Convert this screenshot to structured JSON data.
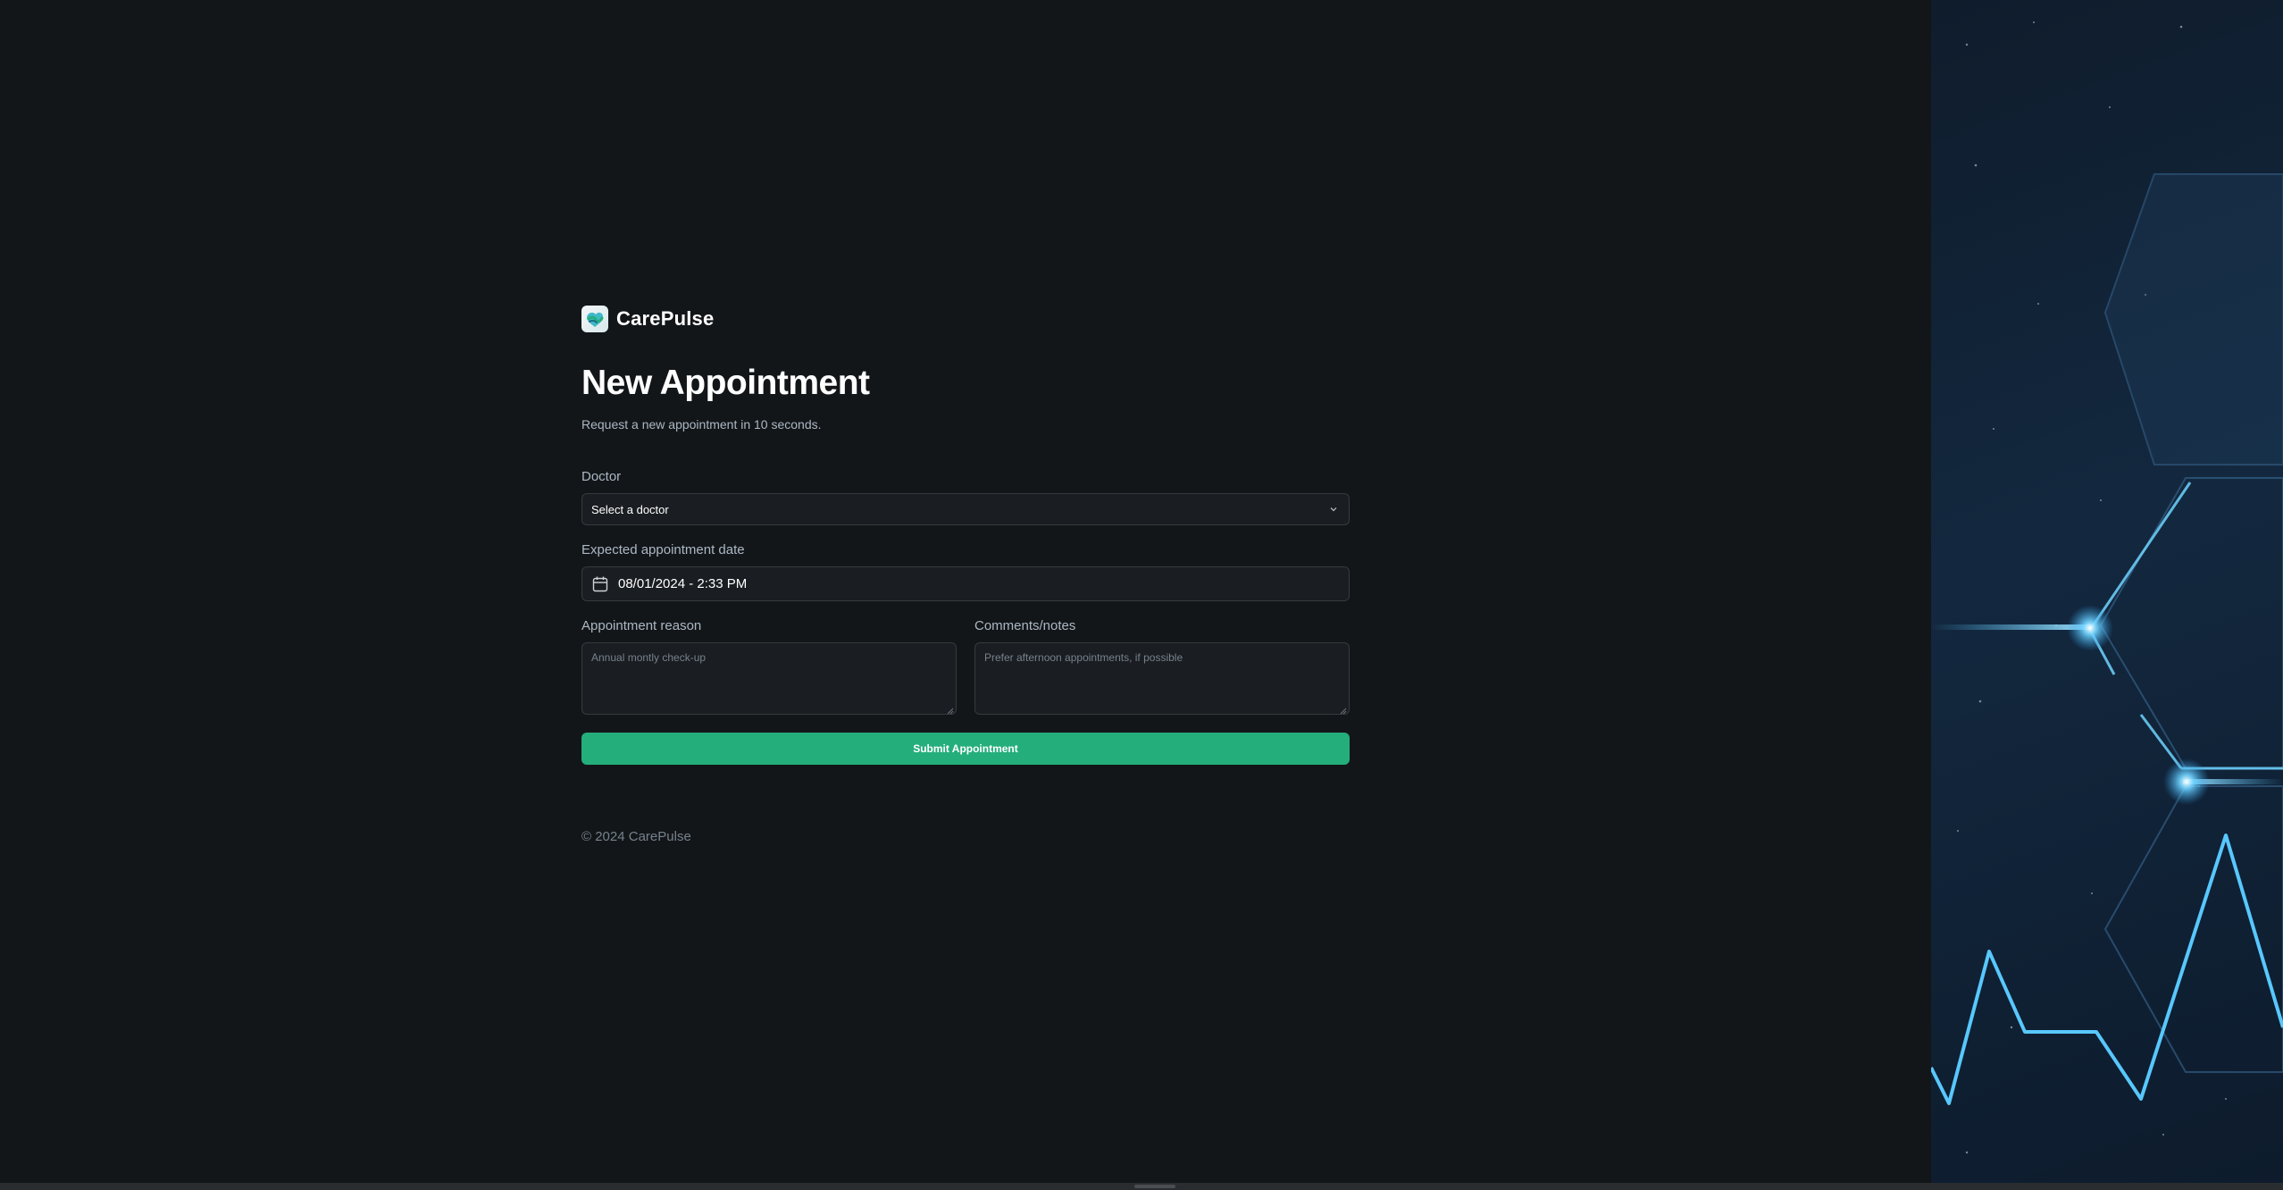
{
  "brand": {
    "name": "CarePulse"
  },
  "header": {
    "title": "New Appointment",
    "subtitle": "Request a new appointment in 10 seconds."
  },
  "form": {
    "doctor": {
      "label": "Doctor",
      "placeholder": "Select a doctor"
    },
    "date": {
      "label": "Expected appointment date",
      "value": "08/01/2024 - 2:33 PM"
    },
    "reason": {
      "label": "Appointment reason",
      "placeholder": "Annual montly check-up"
    },
    "notes": {
      "label": "Comments/notes",
      "placeholder": "Prefer afternoon appointments, if possible"
    },
    "submit_label": "Submit Appointment"
  },
  "footer": {
    "copyright": "© 2024 CarePulse"
  },
  "colors": {
    "background": "#131619",
    "input_background": "#1a1d21",
    "input_border": "#363a3d",
    "accent_green": "#24ae7c",
    "muted_text": "#abb8c4",
    "glow_blue": "#4fc3ff"
  },
  "icons": {
    "logo": "carepulse-logo-icon",
    "select": "chevron-down-icon",
    "date": "calendar-icon"
  }
}
